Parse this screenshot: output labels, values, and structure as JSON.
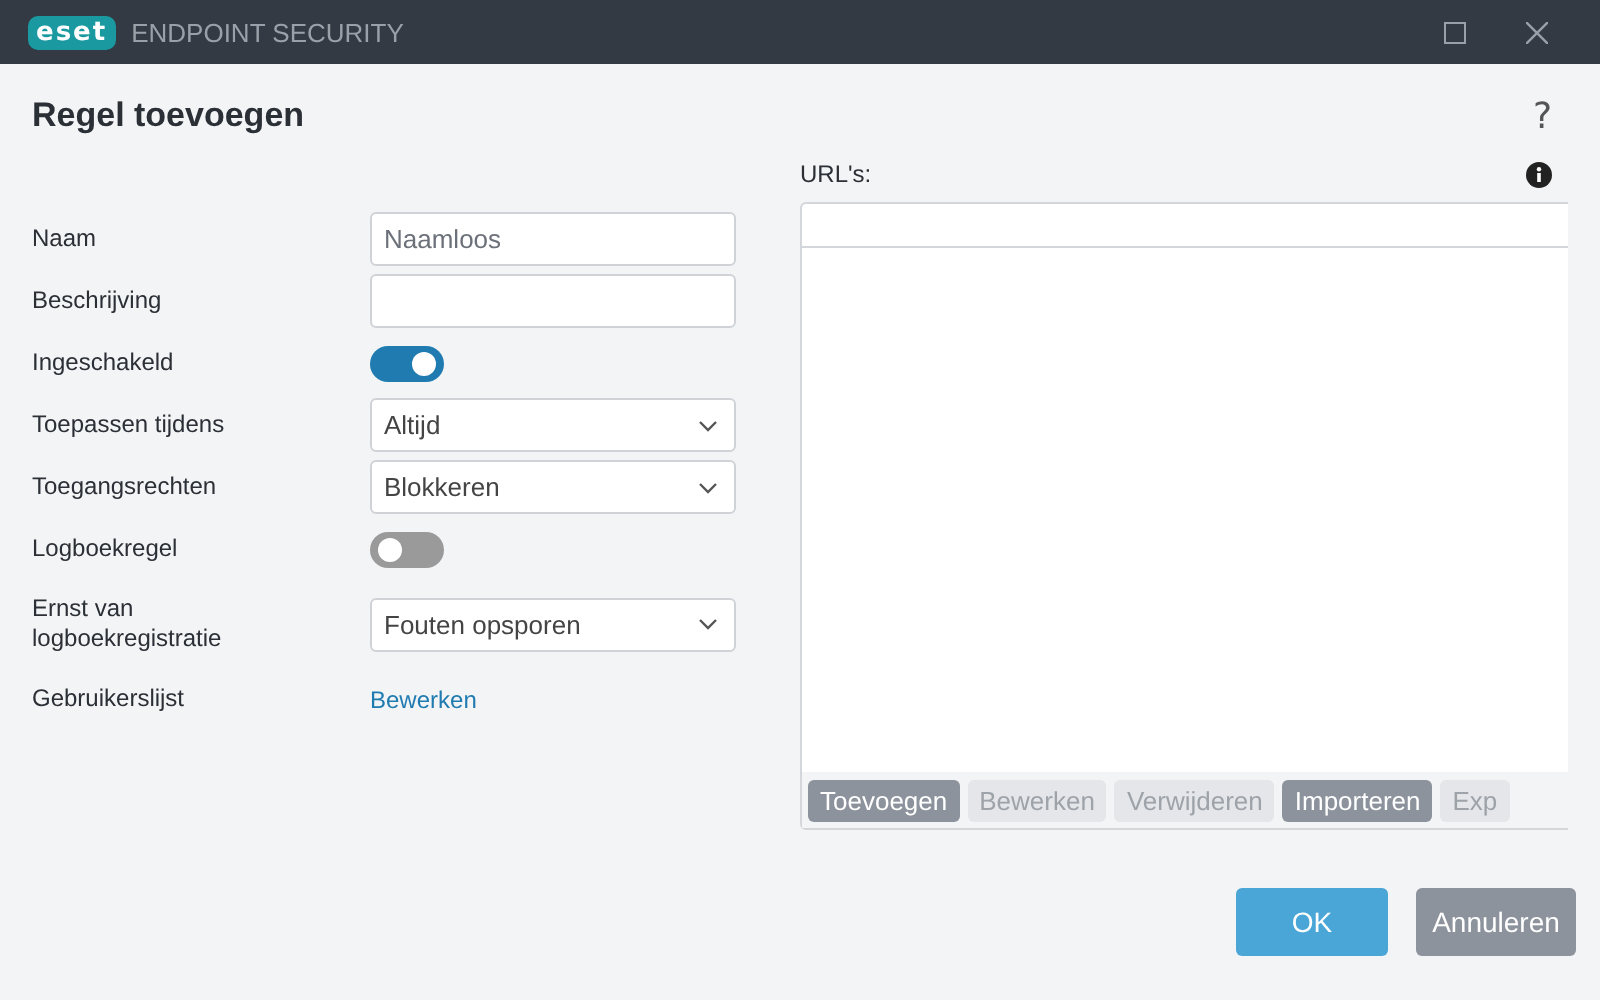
{
  "window": {
    "logo": "eset",
    "product": "ENDPOINT SECURITY"
  },
  "dialog": {
    "title": "Regel toevoegen",
    "help": "?"
  },
  "form": [
    {
      "kind": "text",
      "label": "Naam",
      "placeholder": "Naamloos"
    },
    {
      "kind": "text",
      "label": "Beschrijving"
    },
    {
      "kind": "toggle",
      "label": "Ingeschakeld",
      "on": true
    },
    {
      "kind": "select",
      "label": "Toepassen tijdens",
      "value": "Altijd"
    },
    {
      "kind": "select",
      "label": "Toegangsrechten",
      "value": "Blokkeren"
    },
    {
      "kind": "toggle",
      "label": "Logboekregel",
      "on": false
    },
    {
      "kind": "select",
      "label": "Ernst van logboekregistratie",
      "value": "Fouten opsporen"
    },
    {
      "kind": "link",
      "label": "Gebruikerslijst",
      "value": "Bewerken"
    }
  ],
  "urls": {
    "label": "URL's:",
    "buttons": [
      {
        "label": "Toevoegen",
        "disabled": false
      },
      {
        "label": "Bewerken",
        "disabled": true
      },
      {
        "label": "Verwijderen",
        "disabled": true
      },
      {
        "label": "Importeren",
        "disabled": false
      },
      {
        "label": "Exp",
        "disabled": true
      }
    ]
  },
  "footer": {
    "buttons": [
      {
        "label": "OK",
        "kind": "primary"
      },
      {
        "label": "Annuleren",
        "kind": "secondary"
      }
    ]
  }
}
